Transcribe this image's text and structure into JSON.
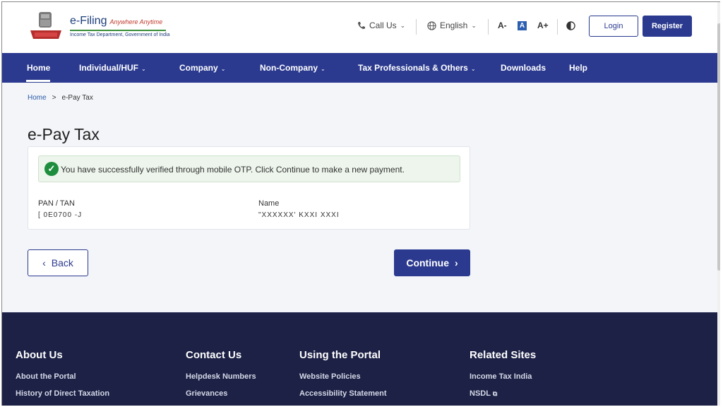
{
  "header": {
    "logo_title": "e-Filing",
    "logo_tagline": "Anywhere Anytime",
    "logo_subtitle": "Income Tax Department, Government of India",
    "call_us": "Call Us",
    "language": "English",
    "font_decrease": "A-",
    "font_default": "A",
    "font_increase": "A+",
    "login_label": "Login",
    "register_label": "Register"
  },
  "nav": {
    "items": [
      {
        "label": "Home",
        "has_dropdown": false,
        "active": true
      },
      {
        "label": "Individual/HUF",
        "has_dropdown": true
      },
      {
        "label": "Company",
        "has_dropdown": true
      },
      {
        "label": "Non-Company",
        "has_dropdown": true
      },
      {
        "label": "Tax Professionals & Others",
        "has_dropdown": true
      },
      {
        "label": "Downloads",
        "has_dropdown": false
      },
      {
        "label": "Help",
        "has_dropdown": false
      }
    ]
  },
  "breadcrumb": {
    "home": "Home",
    "separator": ">",
    "current": "e-Pay Tax"
  },
  "page": {
    "title": "e-Pay Tax",
    "alert_text": "You have successfully verified through mobile OTP. Click Continue to make a new payment.",
    "pan_label": "PAN / TAN",
    "pan_value": "[ 0E0700 -J",
    "name_label": "Name",
    "name_value": "\"XXXXXX'  KXXI    XXXI",
    "back_label": "Back",
    "continue_label": "Continue"
  },
  "footer": {
    "columns": [
      {
        "heading": "About Us",
        "links": [
          "About the Portal",
          "History of Direct Taxation"
        ]
      },
      {
        "heading": "Contact Us",
        "links": [
          "Helpdesk Numbers",
          "Grievances"
        ]
      },
      {
        "heading": "Using the Portal",
        "links": [
          "Website Policies",
          "Accessibility Statement"
        ]
      },
      {
        "heading": "Related Sites",
        "links": [
          "Income Tax India",
          "NSDL"
        ]
      }
    ]
  },
  "colors": {
    "primary": "#2b3a8f",
    "footer_bg": "#1c2145",
    "success": "#1e8e3e",
    "page_bg": "#f3f5f9"
  }
}
